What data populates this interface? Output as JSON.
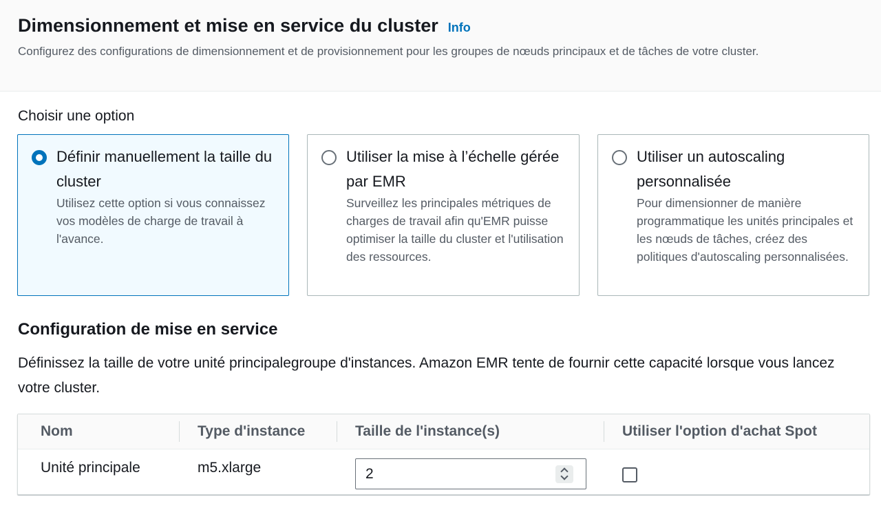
{
  "header": {
    "title": "Dimensionnement et mise en service du cluster",
    "info_link": "Info",
    "description": "Configurez des configurations de dimensionnement et de provisionnement pour les groupes de nœuds principaux et de tâches de votre cluster."
  },
  "options": {
    "label": "Choisir une option",
    "selected": "manual",
    "items": [
      {
        "title": "Définir manuellement la taille du cluster",
        "description": "Utilisez cette option si vous connaissez vos modèles de charge de travail à l'avance."
      },
      {
        "title": "Utiliser la mise à l’échelle gérée par EMR",
        "description": "Surveillez les principales métriques de charges de travail afin qu'EMR puisse optimiser la taille du cluster et l'utilisation des ressources."
      },
      {
        "title": "Utiliser un autoscaling personnalisée",
        "description": "Pour dimensionner de manière programmatique les unités principales et les nœuds de tâches, créez des politiques d'autoscaling personnalisées."
      }
    ]
  },
  "provisioning": {
    "title": "Configuration de mise en service",
    "description": "Définissez la taille de votre unité principalegroupe d'instances. Amazon EMR tente de fournir cette capacité lorsque vous lancez votre cluster.",
    "table": {
      "headers": [
        "Nom",
        "Type d'instance",
        "Taille de l'instance(s)",
        "Utiliser l'option d'achat Spot"
      ],
      "rows": [
        {
          "name": "Unité principale",
          "instance_type": "m5.xlarge",
          "instance_size": "2",
          "spot_checked": false
        }
      ]
    }
  },
  "colors": {
    "accent": "#0073bb",
    "selected_bg": "#f1faff",
    "muted_text": "#545b64"
  }
}
